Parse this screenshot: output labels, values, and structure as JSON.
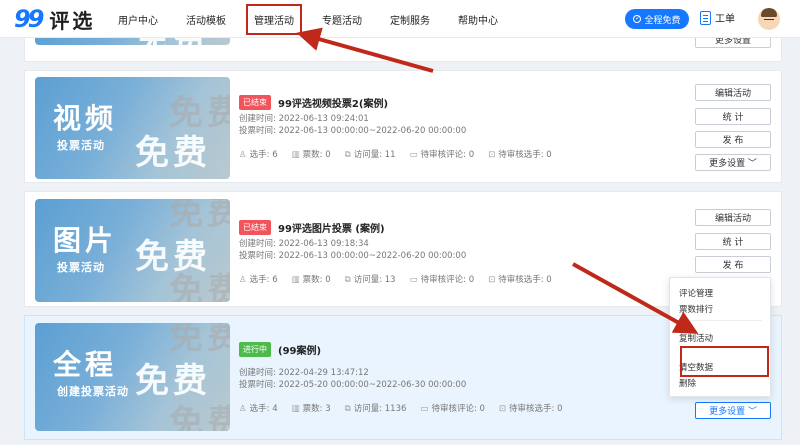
{
  "header": {
    "logo_mark": "99",
    "logo_text": "评选",
    "nav": [
      "用户中心",
      "活动模板",
      "管理活动",
      "专题活动",
      "定制服务",
      "帮助中心"
    ],
    "free_button": "全程免费",
    "ticket": "工单"
  },
  "watermark": {
    "line1": "免费",
    "line2": "免费"
  },
  "cards": [
    {
      "thumb_big": "",
      "thumb_sub": "",
      "buttons": [
        "更多设置"
      ]
    },
    {
      "thumb_big": "视频",
      "thumb_sub": "投票活动",
      "status": "已结束",
      "title": "99评选视频投票2(案例)",
      "created": "创建时间:  2022-06-13 09:24:01",
      "vote_time": "投票时间:  2022-06-13 00:00:00~2022-06-20 00:00:00",
      "stats": [
        "选手:  6",
        "票数:  0",
        "访问量:  11",
        "待审核评论:  0",
        "待审核选手:  0"
      ],
      "buttons": [
        "编辑活动",
        "统 计",
        "发 布",
        "更多设置 ﹀"
      ]
    },
    {
      "thumb_big": "图片",
      "thumb_sub": "投票活动",
      "status": "已结束",
      "title": "99评选图片投票 (案例)",
      "created": "创建时间:  2022-06-13 09:18:34",
      "vote_time": "投票时间:  2022-06-13 00:00:00~2022-06-20 00:00:00",
      "stats": [
        "选手:  6",
        "票数:  0",
        "访问量:  13",
        "待审核评论:  0",
        "待审核选手:  0"
      ],
      "buttons": [
        "编辑活动",
        "统 计",
        "发 布"
      ]
    },
    {
      "thumb_big": "全程",
      "thumb_sub": "创建投票活动",
      "status": "进行中",
      "title": "(99案例)",
      "created": "创建时间:  2022-04-29 13:47:12",
      "vote_time": "投票时间:  2022-05-20 00:00:00~2022-06-30 00:00:00",
      "stats": [
        "选手:  4",
        "票数:  3",
        "访问量:  1136",
        "待审核评论:  0",
        "待审核选手:  0"
      ],
      "buttons": [
        "更多设置 ﹀"
      ]
    }
  ],
  "dropdown": [
    "评论管理",
    "票数排行",
    "复制活动",
    "清空数据",
    "删除"
  ],
  "colors": {
    "primary": "#1677ff",
    "ended": "#f2545b",
    "live": "#4cbb4a",
    "annotation": "#c0281a"
  }
}
